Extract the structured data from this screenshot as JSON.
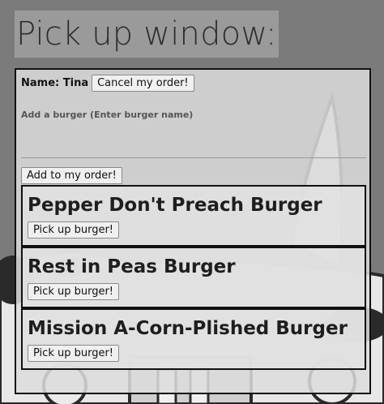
{
  "header": {
    "title": "Pick up window:"
  },
  "order": {
    "name_label": "Name: Tina",
    "cancel_label": "Cancel my order!",
    "add_burger_label": "Add a burger (Enter burger name)",
    "input_value": "",
    "add_button_label": "Add to my order!"
  },
  "burgers": [
    {
      "name": "Pepper Don't Preach Burger",
      "button_label": "Pick up burger!"
    },
    {
      "name": "Rest in Peas Burger",
      "button_label": "Pick up burger!"
    },
    {
      "name": "Mission A-Corn-Plished Burger",
      "button_label": "Pick up burger!"
    }
  ],
  "colors": {
    "background": "#7a7a7a",
    "title_background": "#9a9a9a",
    "title_text": "#2e2e2e",
    "panel_border": "#111111"
  },
  "background_art": {
    "description_icon": "cartoon-burger-character-icon"
  }
}
